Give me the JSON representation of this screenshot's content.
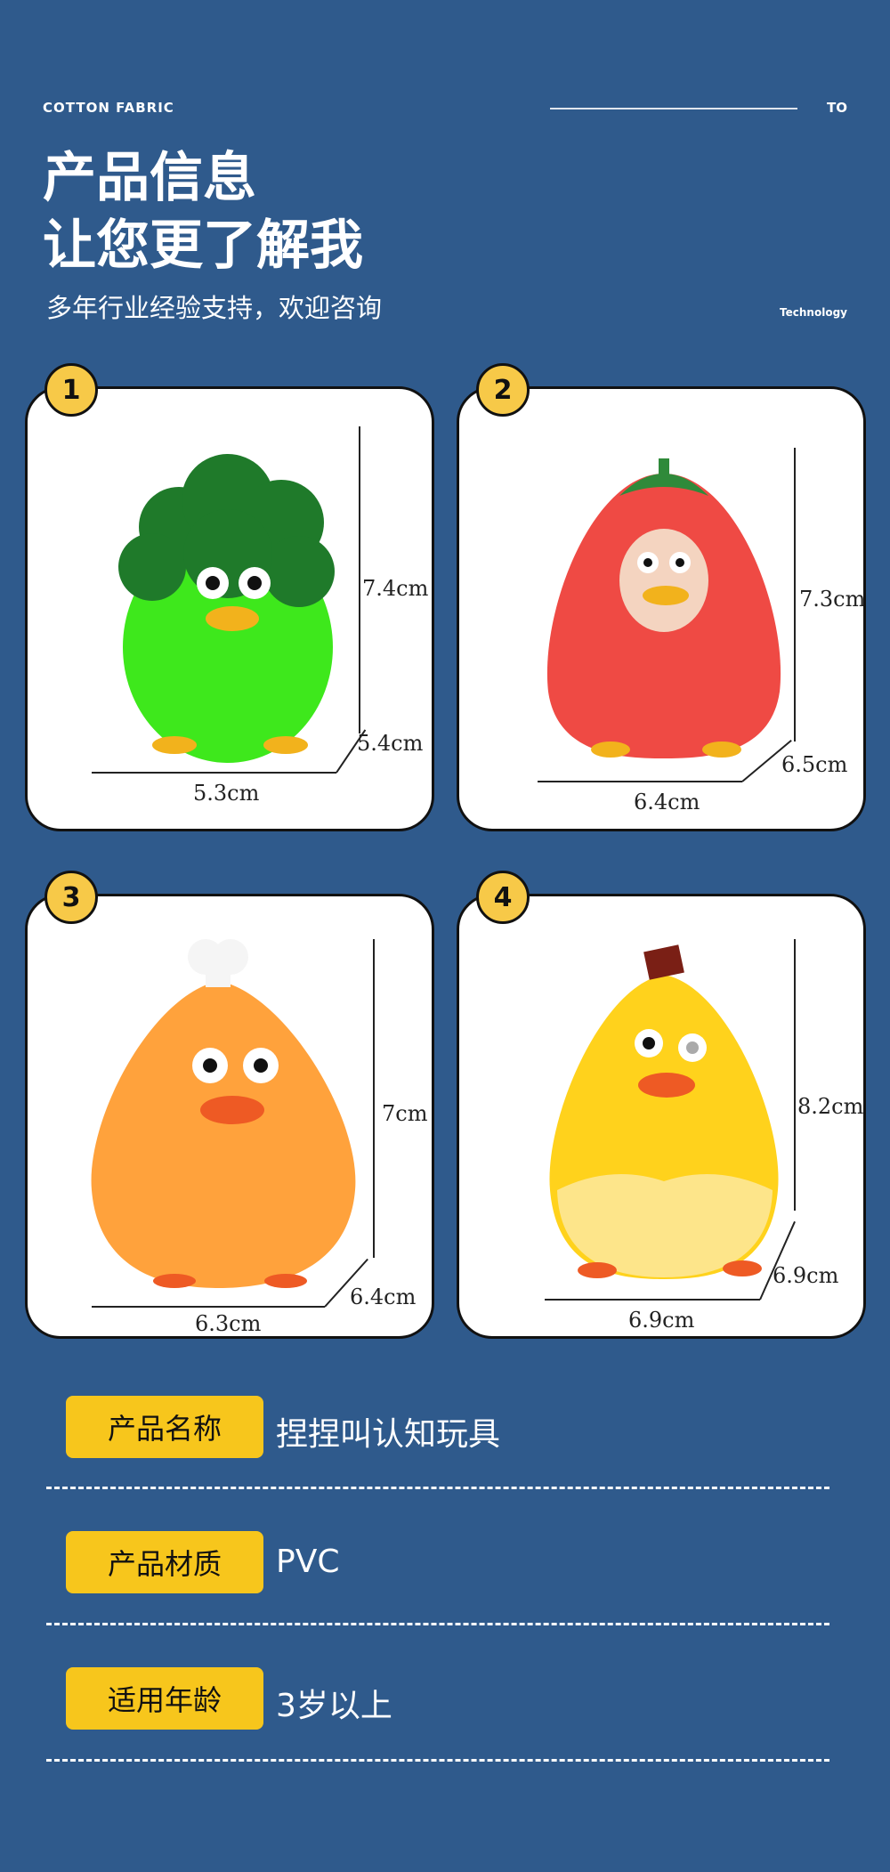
{
  "header": {
    "brand": "COTTON FABRIC",
    "to": "TO",
    "title_line1": "产品信息",
    "title_line2": "让您更了解我",
    "subtitle": "多年行业经验支持，欢迎咨询",
    "tech": "Technology"
  },
  "products": [
    {
      "num": "1",
      "height": "7.4cm",
      "depth": "5.4cm",
      "width": "5.3cm"
    },
    {
      "num": "2",
      "height": "7.3cm",
      "depth": "6.5cm",
      "width": "6.4cm"
    },
    {
      "num": "3",
      "height": "7cm",
      "depth": "6.4cm",
      "width": "6.3cm"
    },
    {
      "num": "4",
      "height": "8.2cm",
      "depth": "6.9cm",
      "width": "6.9cm"
    }
  ],
  "specs": [
    {
      "label": "产品名称",
      "value": "捏捏叫认知玩具"
    },
    {
      "label": "产品材质",
      "value": "PVC"
    },
    {
      "label": "适用年龄",
      "value": "3岁以上"
    }
  ],
  "colors": {
    "background": "#2f5a8c",
    "badge": "#f7c948",
    "pill": "#f7c61c"
  }
}
